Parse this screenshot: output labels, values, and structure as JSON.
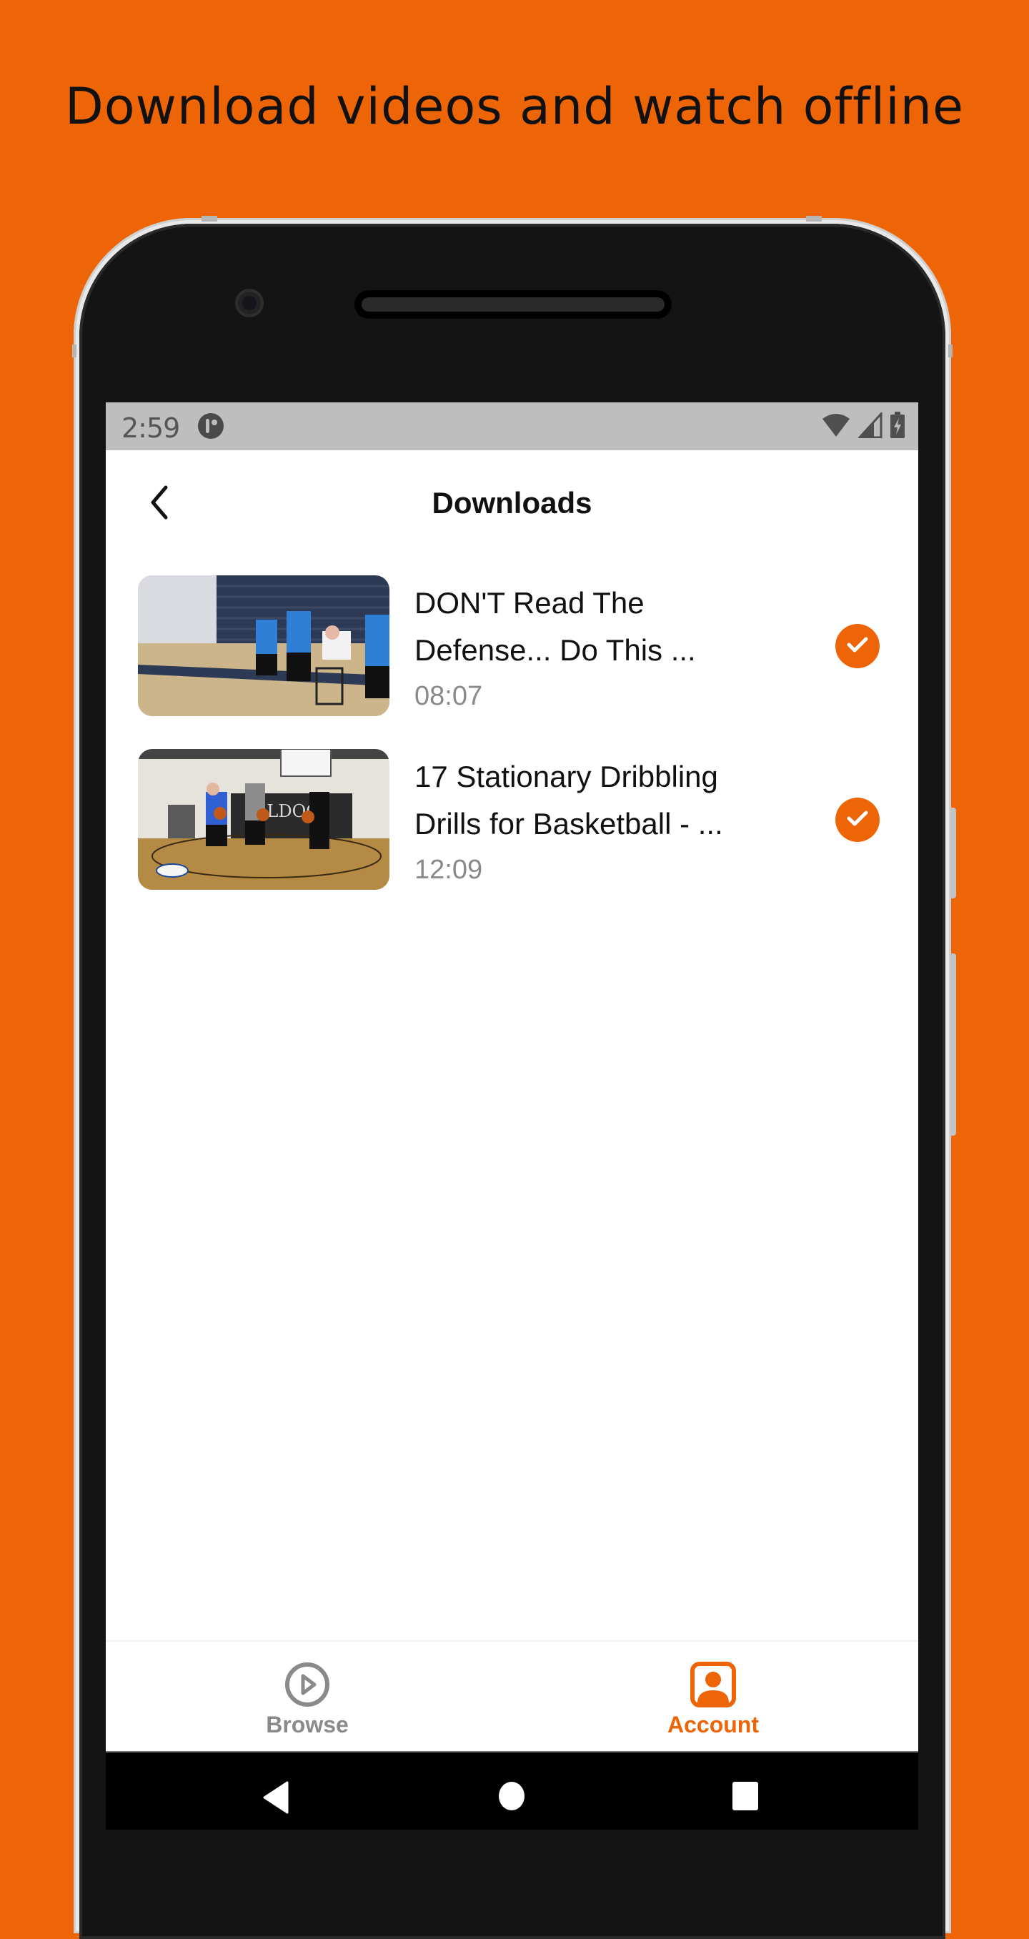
{
  "headline": "Download videos and watch offline",
  "colors": {
    "accent": "#EE6508",
    "background": "#EE6508",
    "status_bar": "#BEBEBE",
    "inactive": "#8a8a8a"
  },
  "status_bar": {
    "time": "2:59",
    "icons": [
      "notification-icon",
      "wifi-icon",
      "cellular-signal-icon",
      "battery-charging-icon"
    ]
  },
  "header": {
    "title": "Downloads",
    "back_icon": "chevron-left-icon"
  },
  "downloads": [
    {
      "title_line1": "DON'T Read The",
      "title_line2": "Defense... Do This ...",
      "duration": "08:07",
      "status_icon": "check-circle-icon"
    },
    {
      "title_line1": "17 Stationary Dribbling",
      "title_line2": "Drills for Basketball - ...",
      "duration": "12:09",
      "status_icon": "check-circle-icon"
    }
  ],
  "bottom_nav": {
    "items": [
      {
        "label": "Browse",
        "icon": "play-circle-icon",
        "active": false
      },
      {
        "label": "Account",
        "icon": "account-box-icon",
        "active": true
      }
    ]
  },
  "system_nav": {
    "buttons": [
      "back-triangle-icon",
      "home-circle-icon",
      "recents-square-icon"
    ]
  }
}
